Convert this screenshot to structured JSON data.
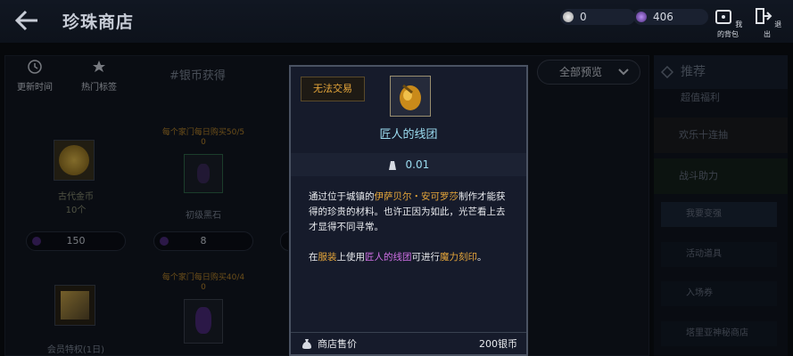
{
  "header": {
    "title": "珍珠商店",
    "silver": "0",
    "pearls": "406",
    "bag_label": "我的背包",
    "exit_label": "退出"
  },
  "tabs": {
    "refresh": "更新时间",
    "hot": "热门标签",
    "search_tag": "#银币获得",
    "preview": "全部预览"
  },
  "cards": [
    {
      "limit": "",
      "name": "古代金币",
      "count": "10个",
      "price": "150"
    },
    {
      "limit": "每个家门每日购买50/5",
      "limit2": "0",
      "name": "初级黑石",
      "count": "",
      "price": "8"
    },
    {
      "limit": "",
      "name": "会员特权(1日)",
      "count": "",
      "price": ""
    },
    {
      "limit": "每个家门每日购买40/4",
      "limit2": "0",
      "name": "",
      "count": "",
      "price": ""
    }
  ],
  "sidebar": {
    "header": "推荐",
    "items": [
      "超值福利",
      "欢乐十连抽",
      "战斗助力"
    ],
    "subitems": [
      "我要变强",
      "活动道具",
      "入场券",
      "塔里亚神秘商店"
    ]
  },
  "tooltip": {
    "badge": "无法交易",
    "name": "匠人的线团",
    "weight": "0.01",
    "desc_1a": "通过位于城镇的",
    "desc_1b": "伊萨贝尔・安可罗莎",
    "desc_1c": "制作才能获得的珍贵的材料。也许正因为如此，光芒看上去才显得不同寻常。",
    "desc_2a": "在",
    "desc_2b": "服装",
    "desc_2c": "上使用",
    "desc_2d": "匠人的线团",
    "desc_2e": "可进行",
    "desc_2f": "魔力刻印",
    "desc_2g": "。",
    "sell_label": "商店售价",
    "sell_value": "200银币"
  },
  "colors": {
    "accent_orange": "#e6a63a",
    "name_cyan": "#9bdcf0",
    "highlight_purple": "#d070e6"
  }
}
